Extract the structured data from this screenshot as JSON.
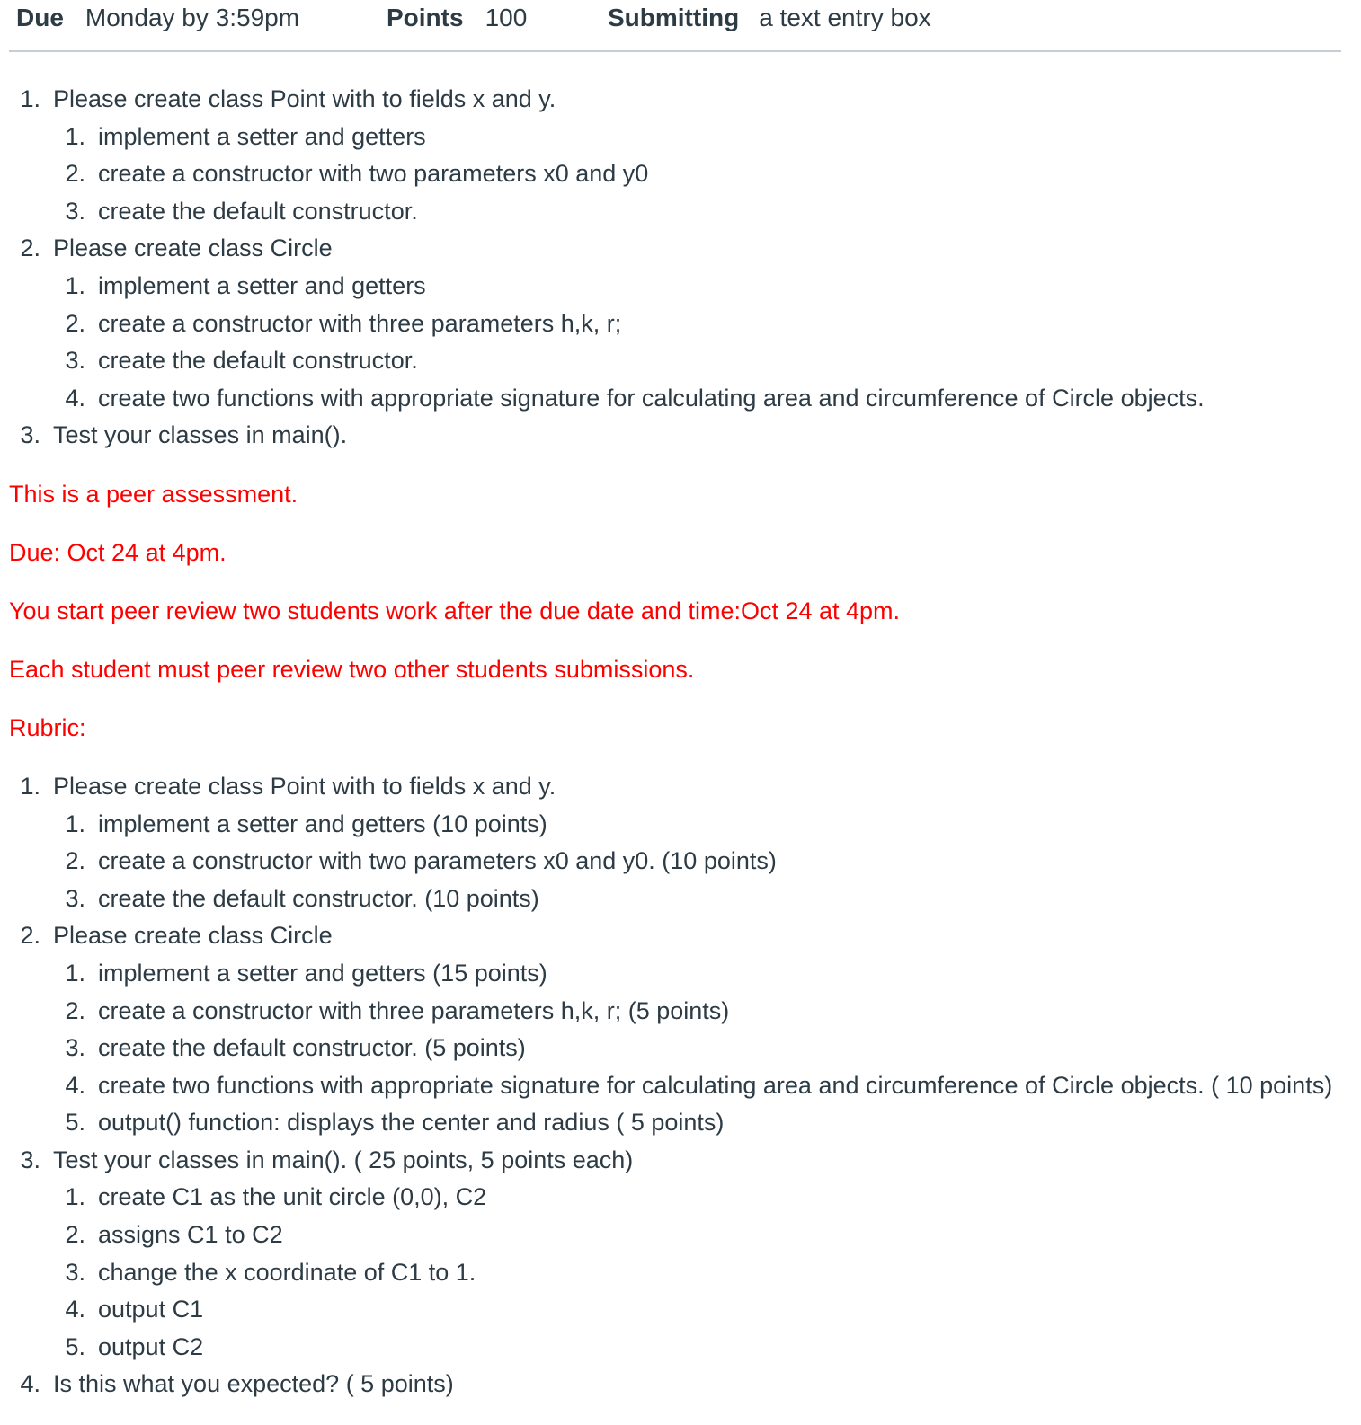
{
  "header": {
    "due_label": "Due",
    "due_value": "Monday by 3:59pm",
    "points_label": "Points",
    "points_value": "100",
    "submitting_label": "Submitting",
    "submitting_value": "a text entry box"
  },
  "instructions": [
    {
      "num": "1.",
      "text": "Please create class Point with to fields x and y.",
      "items": [
        {
          "num": "1.",
          "text": "implement a setter and getters"
        },
        {
          "num": "2.",
          "text": "create a constructor with two parameters x0 and y0"
        },
        {
          "num": "3.",
          "text": "create the default constructor."
        }
      ]
    },
    {
      "num": "2.",
      "text": "Please create class Circle",
      "items": [
        {
          "num": "1.",
          "text": "implement a setter and getters"
        },
        {
          "num": "2.",
          "text": "create a constructor with three parameters h,k, r;"
        },
        {
          "num": "3.",
          "text": "create the default constructor."
        },
        {
          "num": "4.",
          "text": "create two functions with appropriate signature for calculating area and circumference of Circle objects."
        }
      ]
    },
    {
      "num": "3.",
      "text": "Test your classes in main().",
      "items": []
    }
  ],
  "notes": {
    "peer": "This is a peer assessment.",
    "due": "Due: Oct 24 at 4pm.",
    "start": "You start peer review two students work after the due date and time:Oct 24 at 4pm.",
    "each": "Each student must peer review two other students submissions.",
    "rubric": "Rubric:"
  },
  "rubric": [
    {
      "num": "1.",
      "text": "Please create class Point with to fields x and y.",
      "items": [
        {
          "num": "1.",
          "text": "implement a setter and getters (10 points)"
        },
        {
          "num": "2.",
          "text": "create a constructor with two parameters x0 and y0. (10 points)"
        },
        {
          "num": "3.",
          "text": "create the default constructor. (10 points)"
        }
      ]
    },
    {
      "num": "2.",
      "text": "Please create class Circle",
      "items": [
        {
          "num": "1.",
          "text": "implement a setter and getters (15 points)"
        },
        {
          "num": "2.",
          "text": "create a constructor with three parameters h,k, r; (5 points)"
        },
        {
          "num": "3.",
          "text": "create the default constructor. (5 points)"
        },
        {
          "num": "4.",
          "text": "create two functions with appropriate signature for calculating area and circumference of Circle objects. ( 10 points)"
        },
        {
          "num": "5.",
          "text": "output() function: displays the center and radius ( 5 points)"
        }
      ]
    },
    {
      "num": "3.",
      "text": "Test your classes in main(). ( 25 points, 5 points each)",
      "items": [
        {
          "num": "1.",
          "text": "create C1 as the unit circle (0,0), C2"
        },
        {
          "num": "2.",
          "text": "assigns C1 to C2"
        },
        {
          "num": "3.",
          "text": "change the x coordinate of C1 to 1."
        },
        {
          "num": "4.",
          "text": "output C1"
        },
        {
          "num": "5.",
          "text": "output C2"
        }
      ]
    },
    {
      "num": "4.",
      "text": "Is this what you expected? ( 5 points)",
      "items": []
    }
  ]
}
